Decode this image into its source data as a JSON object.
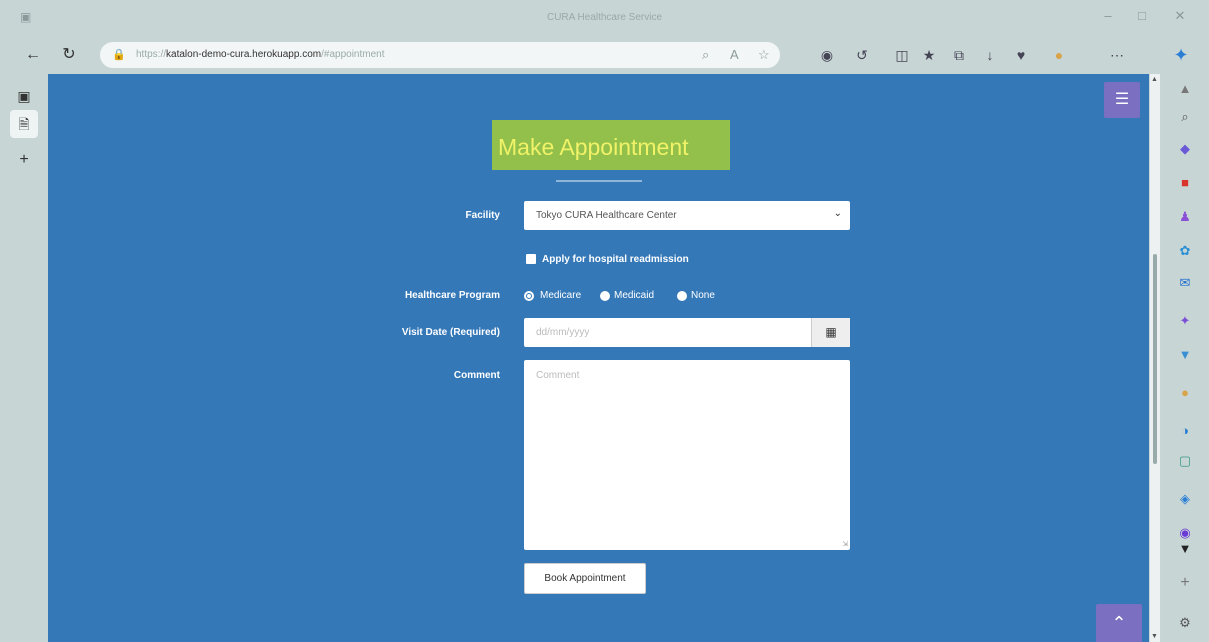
{
  "browser": {
    "window_title": "CURA Healthcare Service",
    "url_prefix": "https://",
    "url_host": "katalon-demo-cura.herokuapp.com",
    "url_path": "/#appointment",
    "icons": [
      "back-icon",
      "refresh-icon",
      "lock-icon",
      "zoom-icon",
      "read-aloud-icon",
      "favorite-icon",
      "extension-icon",
      "browser-essentials-icon",
      "split-screen-icon",
      "favorites-bar-icon",
      "collections-icon",
      "download-icon",
      "heart-icon",
      "profile-icon",
      "more-icon",
      "copilot-icon"
    ]
  },
  "page": {
    "menu_icon": "hamburger-icon",
    "heading": "Make Appointment",
    "form": {
      "facility_label": "Facility",
      "facility_value": "Tokyo CURA Healthcare Center",
      "readmission_label": "Apply for hospital readmission",
      "program_label": "Healthcare Program",
      "programs": [
        "Medicare",
        "Medicaid",
        "None"
      ],
      "selected_program": "Medicare",
      "visit_date_label": "Visit Date (Required)",
      "visit_date_placeholder": "dd/mm/yyyy",
      "comment_label": "Comment",
      "comment_placeholder": "Comment",
      "book_button": "Book Appointment"
    },
    "scroll_top_icon": "chevron-up-icon"
  },
  "colors": {
    "page_bg": "#3478b8",
    "menu_accent": "#7a6fc0",
    "heading_highlight": "#93c04a",
    "heading_text": "#f0f268"
  }
}
